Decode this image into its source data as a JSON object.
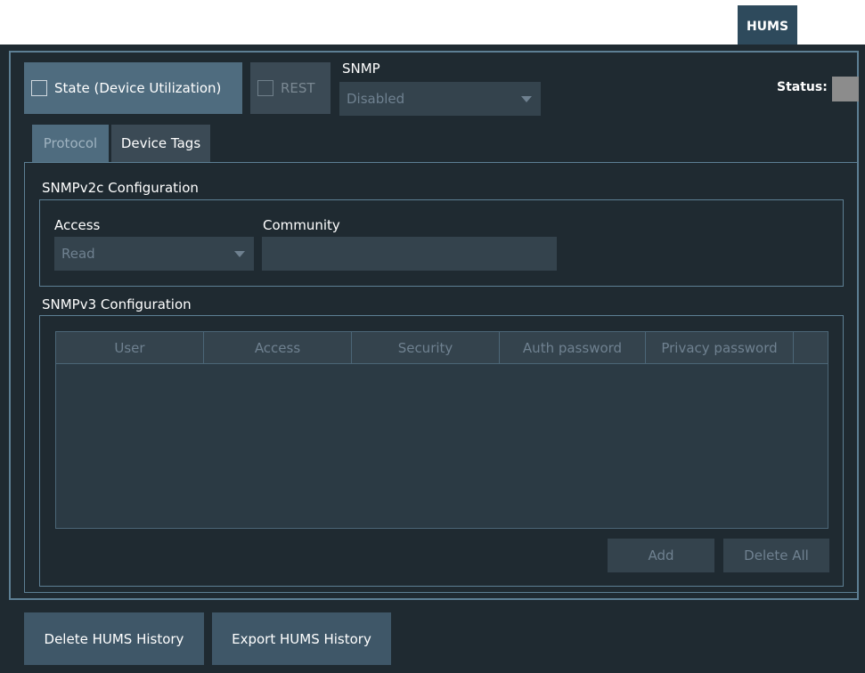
{
  "top_tab": {
    "label": "HUMS"
  },
  "toolbar": {
    "state_label": "State (Device Utilization)",
    "rest_label": "REST",
    "snmp_label": "SNMP",
    "snmp_value": "Disabled",
    "status_label": "Status:"
  },
  "tabs": [
    {
      "label": "Protocol"
    },
    {
      "label": "Device Tags"
    }
  ],
  "snmpv2c": {
    "title": "SNMPv2c Configuration",
    "access_label": "Access",
    "access_value": "Read",
    "community_label": "Community",
    "community_value": ""
  },
  "snmpv3": {
    "title": "SNMPv3 Configuration",
    "columns": [
      "User",
      "Access",
      "Security",
      "Auth password",
      "Privacy password",
      ""
    ],
    "rows": [],
    "add_label": "Add",
    "delete_all_label": "Delete All"
  },
  "footer": {
    "delete_history_label": "Delete HUMS History",
    "export_history_label": "Export HUMS History"
  },
  "colors": {
    "background": "#1f2a31",
    "accent": "#4f6c7f",
    "border": "#5d7f94",
    "status_indicator": "#8c8c8c"
  }
}
